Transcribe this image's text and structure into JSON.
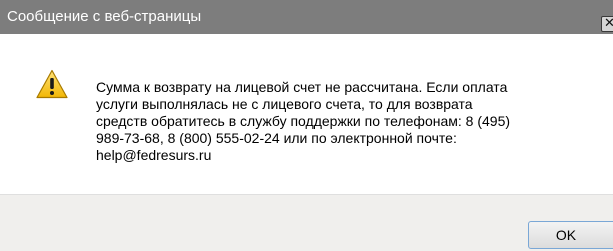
{
  "window": {
    "title": "Сообщение с веб-страницы",
    "close_icon": "close-icon",
    "close_glyph": "✕"
  },
  "message": {
    "icon": "warning-icon",
    "text": "Сумма к возврату на лицевой счет не рассчитана. Если оплата\nуслуги выполнялась не с лицевого счета, то для возврата\nсредств обратитесь в службу поддержки по телефонам: 8 (495)\n989-73-68,  8 (800) 555-02-24 или по электронной почте:\n help@fedresurs.ru"
  },
  "buttons": {
    "ok_label": "OK"
  },
  "colors": {
    "titlebar": "#7d7d7d",
    "footer": "#f0efed",
    "warning_fill": "#f6c21c",
    "warning_stroke": "#a87a00"
  }
}
